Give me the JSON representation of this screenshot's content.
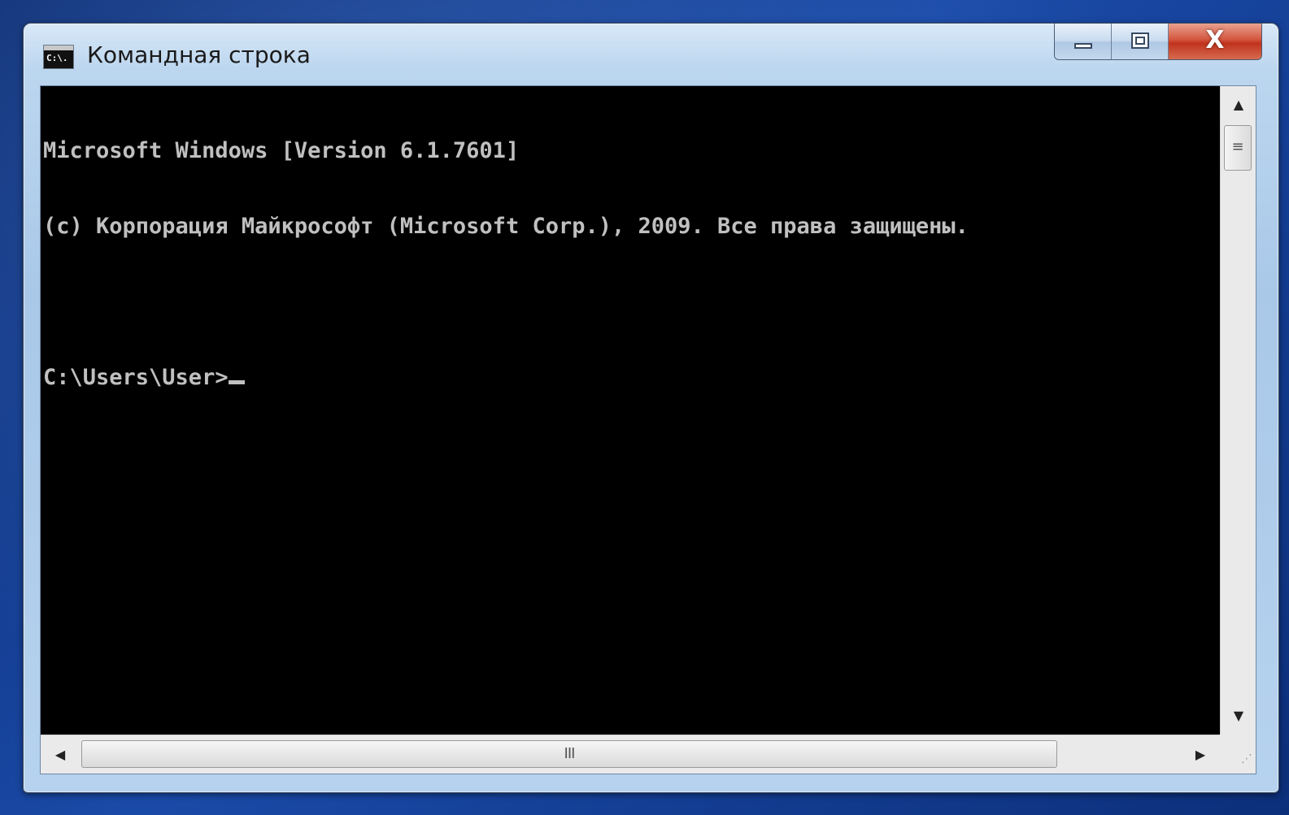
{
  "window": {
    "title": "Командная строка",
    "icon": "cmd-icon",
    "icon_text": "C:\\."
  },
  "caption_buttons": {
    "minimize": "minimize-icon",
    "maximize": "maximize-icon",
    "close": "X"
  },
  "console": {
    "lines": [
      "Microsoft Windows [Version 6.1.7601]",
      "(c) Корпорация Майкрософт (Microsoft Corp.), 2009. Все права защищены.",
      "",
      "C:\\Users\\User>"
    ],
    "background_color": "#000000",
    "text_color": "#c0c0c0"
  },
  "scrollbars": {
    "vertical_up": "▲",
    "vertical_down": "▼",
    "vertical_thumb_grip": "≡",
    "horizontal_left": "◀",
    "horizontal_right": "▶",
    "horizontal_thumb_grip": "III",
    "size_grip": "⋰"
  }
}
